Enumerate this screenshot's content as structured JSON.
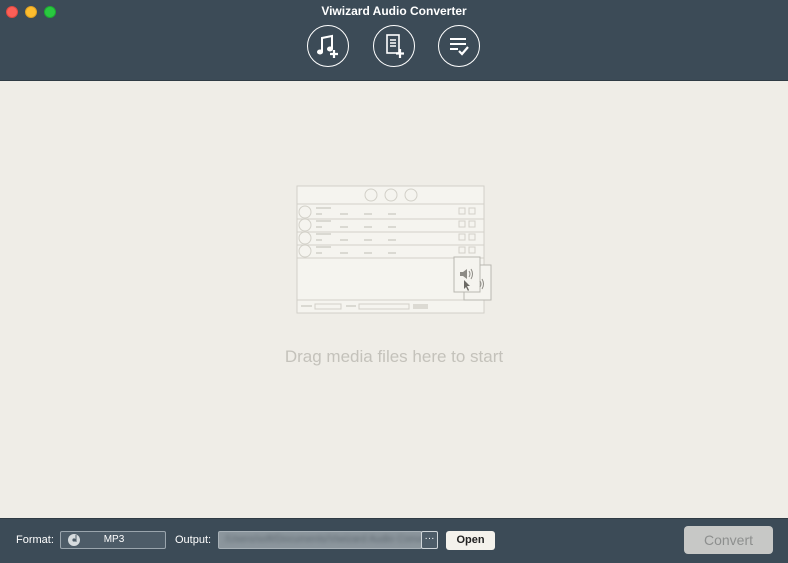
{
  "window": {
    "title": "Viwizard Audio Converter"
  },
  "toolbar": {
    "buttons": [
      {
        "icon": "music-add-icon"
      },
      {
        "icon": "file-add-icon"
      },
      {
        "icon": "checklist-icon"
      }
    ]
  },
  "dropzone": {
    "message": "Drag media files here to start"
  },
  "footer": {
    "format_label": "Format:",
    "format_value": "MP3",
    "output_label": "Output:",
    "output_path": "/Users/soft/Documents/Viwizard Audio Converter",
    "browse_label": "···",
    "open_label": "Open",
    "convert_label": "Convert"
  },
  "colors": {
    "header_bg": "#3c4b57",
    "content_bg": "#efede7",
    "convert_disabled_bg": "#c7c8c6"
  }
}
